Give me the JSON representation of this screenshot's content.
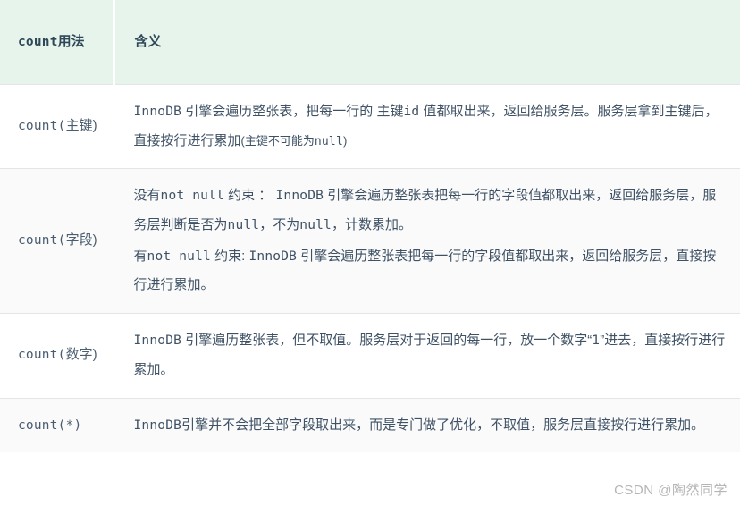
{
  "table": {
    "headers": {
      "usage_code": "count",
      "usage_text": "用法",
      "meaning": "含义"
    },
    "rows": [
      {
        "usage_code": "count(",
        "usage_text": "主键)",
        "usage_full": "count(主键)",
        "paragraphs": [
          [
            {
              "t": "code",
              "v": "InnoDB"
            },
            {
              "t": "text",
              "v": " 引擎会遍历整张表，把每一行的 "
            },
            {
              "t": "text",
              "v": "主键"
            },
            {
              "t": "code",
              "v": "id"
            },
            {
              "t": "text",
              "v": " 值都取出来，返回给服务层。服务层拿到主键后，直接按行进行累加"
            },
            {
              "t": "small",
              "v": "(主键不可能为"
            },
            {
              "t": "smallcode",
              "v": "null"
            },
            {
              "t": "small",
              "v": ")"
            }
          ]
        ]
      },
      {
        "usage_code": "count(",
        "usage_text": "字段)",
        "usage_full": "count(字段)",
        "paragraphs": [
          [
            {
              "t": "text",
              "v": "没有"
            },
            {
              "t": "code",
              "v": "not null"
            },
            {
              "t": "text",
              "v": " 约束 ： "
            },
            {
              "t": "code",
              "v": "InnoDB"
            },
            {
              "t": "text",
              "v": " 引擎会遍历整张表把每一行的字段值都取出来，返回给服务层，服务层判断是否为"
            },
            {
              "t": "code",
              "v": "null"
            },
            {
              "t": "text",
              "v": "，不为"
            },
            {
              "t": "code",
              "v": "null"
            },
            {
              "t": "text",
              "v": "，计数累加。"
            }
          ],
          [
            {
              "t": "text",
              "v": "有"
            },
            {
              "t": "code",
              "v": "not null"
            },
            {
              "t": "text",
              "v": " 约束: "
            },
            {
              "t": "code",
              "v": "InnoDB"
            },
            {
              "t": "text",
              "v": " 引擎会遍历整张表把每一行的字段值都取出来，返回给服务层，直接按行进行累加。"
            }
          ]
        ]
      },
      {
        "usage_code": "count(",
        "usage_text": "数字)",
        "usage_full": "count(数字)",
        "paragraphs": [
          [
            {
              "t": "code",
              "v": "InnoDB"
            },
            {
              "t": "text",
              "v": " 引擎遍历整张表，但不取值。服务层对于返回的每一行，放一个数字“"
            },
            {
              "t": "code",
              "v": "1"
            },
            {
              "t": "text",
              "v": "”进去，直接按行进行累加。"
            }
          ]
        ]
      },
      {
        "usage_code": "count(*)",
        "usage_text": "",
        "usage_full": "count(*)",
        "paragraphs": [
          [
            {
              "t": "code",
              "v": "InnoDB"
            },
            {
              "t": "text",
              "v": "引擎并不会把全部字段取出来，而是专门做了优化，不取值，服务层直接按行进行累加。"
            }
          ]
        ]
      }
    ]
  },
  "watermark": "CSDN @陶然同学",
  "colors": {
    "header_bg": "#e7f4ec",
    "header_text": "#2f4858",
    "body_text": "#3f5265",
    "row_shade": "#fafafa",
    "border": "#e3e6e8",
    "watermark_text": "#b5b5b5"
  }
}
